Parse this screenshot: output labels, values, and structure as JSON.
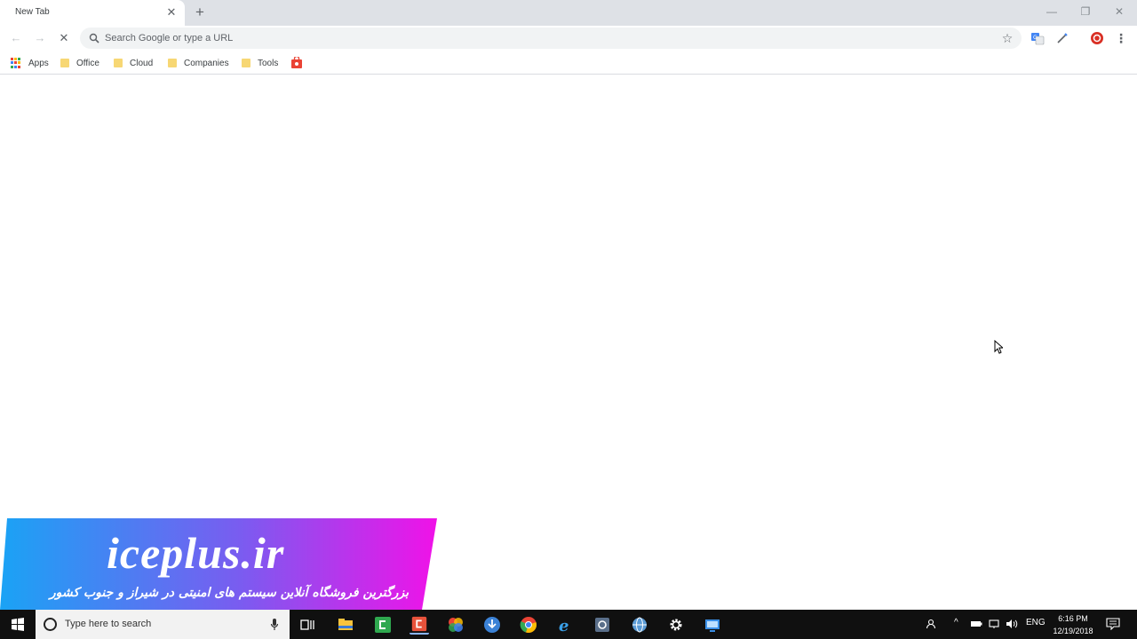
{
  "tabs": [
    {
      "title": "New Tab"
    }
  ],
  "window_controls": {
    "minimize": "—",
    "maximize": "❐",
    "close": "✕"
  },
  "omnibox": {
    "placeholder": "Search Google or type a URL"
  },
  "bookmarks": [
    {
      "label": "Apps",
      "type": "apps"
    },
    {
      "label": "Office",
      "type": "folder"
    },
    {
      "label": "Cloud",
      "type": "folder"
    },
    {
      "label": "Companies",
      "type": "folder"
    },
    {
      "label": "Tools",
      "type": "folder"
    }
  ],
  "watermark": {
    "title": "iceplus.ir",
    "subtitle": "بزرگترین فروشگاه آنلاین سیستم های امنیتی در شیراز و جنوب کشور"
  },
  "taskbar": {
    "search_placeholder": "Type here to search",
    "language": "ENG",
    "time": "6:16 PM",
    "date": "12/19/2018"
  },
  "colors": {
    "tabstrip": "#dee1e6",
    "taskbar": "#101010",
    "folder": "#f7d774",
    "watermark_start": "#1aa3f5",
    "watermark_end": "#f012e8"
  }
}
